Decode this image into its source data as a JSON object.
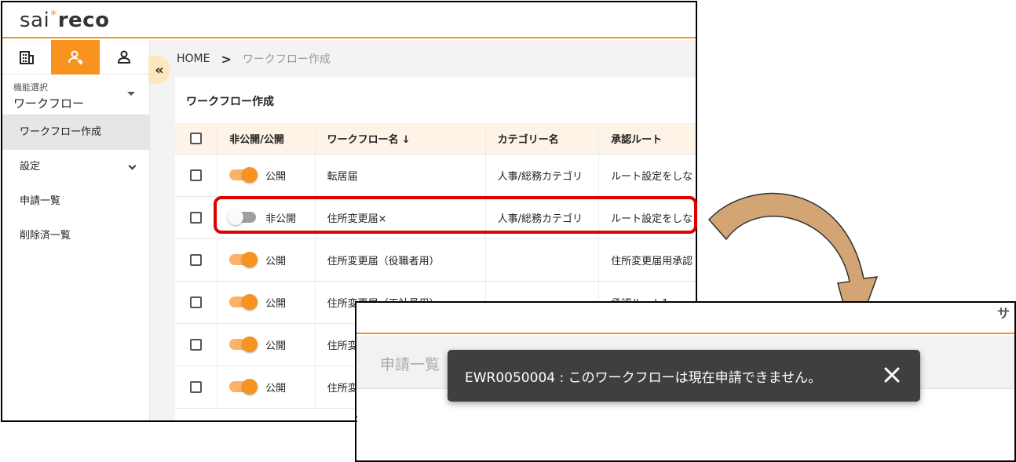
{
  "app": {
    "logo_left": "sai",
    "logo_star": "*",
    "logo_right": "reco"
  },
  "sidebar": {
    "icons": [
      "building-icon",
      "user-tools-icon",
      "person-icon"
    ],
    "active_icon_index": 1,
    "function_select": {
      "label": "機能選択",
      "value": "ワークフロー"
    },
    "items": [
      {
        "label": "ワークフロー作成",
        "active": true
      },
      {
        "label": "設定",
        "expandable": true
      },
      {
        "label": "申請一覧"
      },
      {
        "label": "削除済一覧"
      }
    ]
  },
  "breadcrumb": {
    "home": "HOME",
    "separator": ">",
    "current": "ワークフロー作成"
  },
  "collapse_glyph": "«",
  "card": {
    "title": "ワークフロー作成",
    "columns": [
      "非公開/公開",
      "ワークフロー名",
      "カテゴリー名",
      "承認ルート"
    ],
    "sort_arrow": "↓",
    "rows": [
      {
        "public": true,
        "status": "公開",
        "name": "転居届",
        "category": "人事/総務カテゴリ",
        "route": "ルート設定をしな"
      },
      {
        "public": false,
        "status": "非公開",
        "name": "住所変更届×",
        "category": "人事/総務カテゴリ",
        "route": "ルート設定をしな"
      },
      {
        "public": true,
        "status": "公開",
        "name": "住所変更届（役職者用）",
        "category": "",
        "route": "住所変更届用承認"
      },
      {
        "public": true,
        "status": "公開",
        "name": "住所変更届（正社員用）",
        "category": "",
        "route": "承認ルート1"
      },
      {
        "public": true,
        "status": "公開",
        "name": "住所変",
        "category": "",
        "route": ""
      },
      {
        "public": true,
        "status": "公開",
        "name": "住所変",
        "category": "",
        "route": ""
      }
    ]
  },
  "sub_window": {
    "edge_char": "サ",
    "title": "申請一覧",
    "colon": ":"
  },
  "toast": {
    "message": "EWR0050004 : このワークフローは現在申請できません。",
    "close_glyph": "×"
  },
  "colors": {
    "accent": "#f7931e",
    "highlight": "#e00000",
    "toast_bg": "#3f3f3f",
    "arrow_fill": "#d4a574"
  }
}
